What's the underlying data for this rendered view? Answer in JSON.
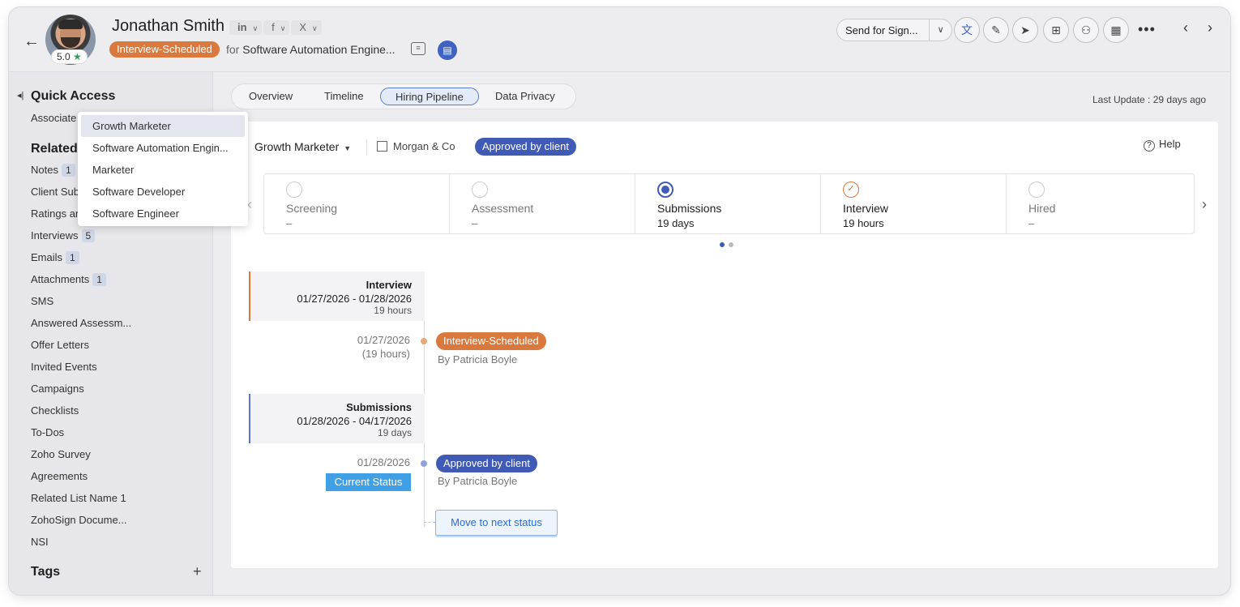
{
  "header": {
    "name": "Jonathan Smith",
    "rating": "5.0",
    "social": [
      "in",
      "f",
      "X"
    ],
    "status": "Interview-Scheduled",
    "for_prefix": "for",
    "job_title": "Software Automation Engine...",
    "send_for_sign": "Send for Sign...",
    "more": "•••"
  },
  "sidebar": {
    "quick_access_title": "Quick Access",
    "associate": "Associate",
    "related_title": "Related",
    "items": [
      {
        "label": "Notes",
        "count": "1"
      },
      {
        "label": "Client Sub",
        "count": ""
      },
      {
        "label": "Ratings ar",
        "count": ""
      },
      {
        "label": "Interviews",
        "count": "5"
      },
      {
        "label": "Emails",
        "count": "1"
      },
      {
        "label": "Attachments",
        "count": "1"
      },
      {
        "label": "SMS",
        "count": ""
      },
      {
        "label": "Answered Assessm...",
        "count": ""
      },
      {
        "label": "Offer Letters",
        "count": ""
      },
      {
        "label": "Invited Events",
        "count": ""
      },
      {
        "label": "Campaigns",
        "count": ""
      },
      {
        "label": "Checklists",
        "count": ""
      },
      {
        "label": "To-Dos",
        "count": ""
      },
      {
        "label": "Zoho Survey",
        "count": ""
      },
      {
        "label": "Agreements",
        "count": ""
      },
      {
        "label": "Related List Name 1",
        "count": ""
      },
      {
        "label": "ZohoSign Docume...",
        "count": ""
      },
      {
        "label": "NSI",
        "count": ""
      }
    ],
    "tags_title": "Tags",
    "tags_add": "+"
  },
  "tabs": [
    "Overview",
    "Timeline",
    "Hiring Pipeline",
    "Data Privacy"
  ],
  "active_tab": "Hiring Pipeline",
  "last_update": "Last Update : 29 days ago",
  "pipeline": {
    "job_select": "Growth Marketer",
    "client": "Morgan & Co",
    "client_status": "Approved by client",
    "help": "Help",
    "stages": [
      {
        "name": "Screening",
        "duration": "–",
        "state": "pending"
      },
      {
        "name": "Assessment",
        "duration": "–",
        "state": "pending"
      },
      {
        "name": "Submissions",
        "duration": "19 days",
        "state": "current"
      },
      {
        "name": "Interview",
        "duration": "19 hours",
        "state": "done"
      },
      {
        "name": "Hired",
        "duration": "–",
        "state": "pending"
      }
    ]
  },
  "timeline": {
    "groups": [
      {
        "title": "Interview",
        "range": "01/27/2026 - 01/28/2026",
        "duration": "19 hours"
      },
      {
        "title": "Submissions",
        "range": "01/28/2026 - 04/17/2026",
        "duration": "19 days"
      }
    ],
    "events": [
      {
        "date": "01/27/2026",
        "sub": "(19 hours)",
        "status": "Interview-Scheduled",
        "by": "By Patricia Boyle"
      },
      {
        "date": "01/28/2026",
        "status": "Approved by client",
        "by": "By Patricia Boyle"
      }
    ],
    "current_status": "Current Status",
    "move_next": "Move to next status"
  },
  "dropdown": {
    "options": [
      "Growth Marketer",
      "Software Automation Engin...",
      "Marketer",
      "Software Developer",
      "Software Engineer"
    ],
    "selected": "Growth Marketer"
  },
  "colors": {
    "accent_blue": "#3f5bb6",
    "status_orange": "#d9793d",
    "current_status_blue": "#3fa0e6"
  },
  "icons": [
    "back-arrow-icon",
    "star-icon",
    "linkedin-icon",
    "facebook-icon",
    "x-icon",
    "note-icon",
    "document-icon",
    "chevron-down-icon",
    "translate-icon",
    "edit-icon",
    "send-icon",
    "briefcase-icon",
    "assign-user-icon",
    "calendar-icon",
    "more-icon",
    "chevron-left-icon",
    "chevron-right-icon",
    "collapse-icon",
    "building-icon",
    "help-icon",
    "check-icon"
  ]
}
